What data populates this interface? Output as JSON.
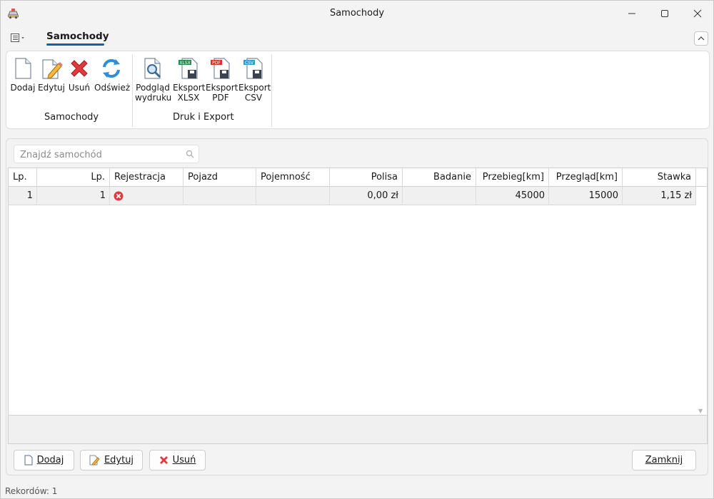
{
  "window": {
    "title": "Samochody"
  },
  "ribbon": {
    "tab": "Samochody",
    "groups": [
      {
        "label": "Samochody",
        "buttons": [
          {
            "label": "Dodaj",
            "icon": "new-document-icon"
          },
          {
            "label": "Edytuj",
            "icon": "edit-document-icon"
          },
          {
            "label": "Usuń",
            "icon": "delete-x-icon"
          },
          {
            "label": "Odśwież",
            "icon": "refresh-icon"
          }
        ]
      },
      {
        "label": "Druk i Export",
        "buttons": [
          {
            "label_line1": "Podgląd",
            "label_line2": "wydruku",
            "icon": "print-preview-icon"
          },
          {
            "label_line1": "Eksport",
            "label_line2": "XLSX",
            "icon": "export-xlsx-icon"
          },
          {
            "label_line1": "Eksport",
            "label_line2": "PDF",
            "icon": "export-pdf-icon"
          },
          {
            "label_line1": "Eksport",
            "label_line2": "CSV",
            "icon": "export-csv-icon"
          }
        ]
      }
    ]
  },
  "icon_badges": {
    "xlsx": "XLSX",
    "pdf": "PDF",
    "csv": "CSV"
  },
  "search": {
    "placeholder": "Znajdź samochód",
    "value": ""
  },
  "table": {
    "columns": [
      "Lp.",
      "Lp.",
      "Rejestracja",
      "Pojazd",
      "Pojemność",
      "Polisa",
      "Badanie",
      "Przebieg[km]",
      "Przegląd[km]",
      "Stawka"
    ],
    "rows": [
      {
        "lp1": "1",
        "lp2": "1",
        "rejestracja": "",
        "rejestracja_icon": "error-circle-icon",
        "pojazd": "",
        "pojemnosc": "",
        "polisa": "0,00 zł",
        "badanie": "",
        "przebieg": "45000",
        "przeglad": "15000",
        "stawka": "1,15 zł"
      }
    ]
  },
  "buttons": {
    "add": "Dodaj",
    "edit": "Edytuj",
    "delete": "Usuń",
    "close": "Zamknij"
  },
  "status": {
    "records": "Rekordów: 1"
  },
  "colors": {
    "accent": "#0f5fb0",
    "error": "#e0393e"
  }
}
